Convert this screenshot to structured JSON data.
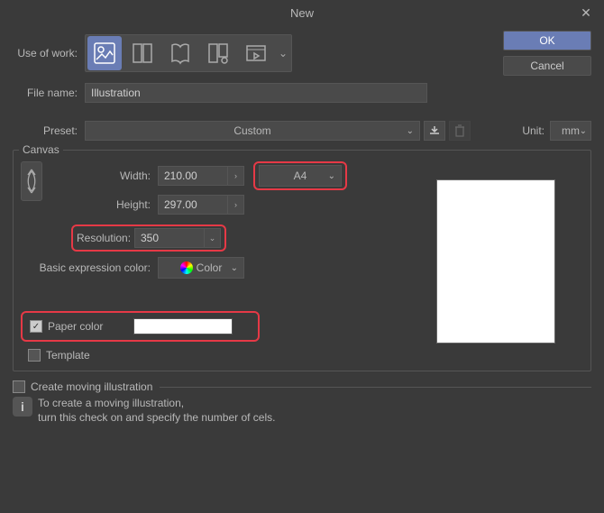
{
  "window": {
    "title": "New"
  },
  "buttons": {
    "ok": "OK",
    "cancel": "Cancel"
  },
  "labels": {
    "use_of_work": "Use of work:",
    "file_name": "File name:",
    "preset": "Preset:",
    "unit": "Unit:",
    "width": "Width:",
    "height": "Height:",
    "resolution": "Resolution:",
    "basic_expression_color": "Basic expression color:",
    "paper_color": "Paper color",
    "template": "Template",
    "create_moving": "Create moving illustration"
  },
  "values": {
    "file_name": "Illustration",
    "preset": "Custom",
    "unit": "mm",
    "width": "210.00",
    "height": "297.00",
    "size_preset": "A4",
    "resolution": "350",
    "expression_color": "Color",
    "paper_color_hex": "#ffffff",
    "paper_color_checked": true,
    "template_checked": false,
    "create_moving_checked": false
  },
  "info": {
    "line1": "To create a moving illustration,",
    "line2": "turn this check on and specify the number of cels."
  },
  "fieldset": {
    "canvas": "Canvas"
  }
}
